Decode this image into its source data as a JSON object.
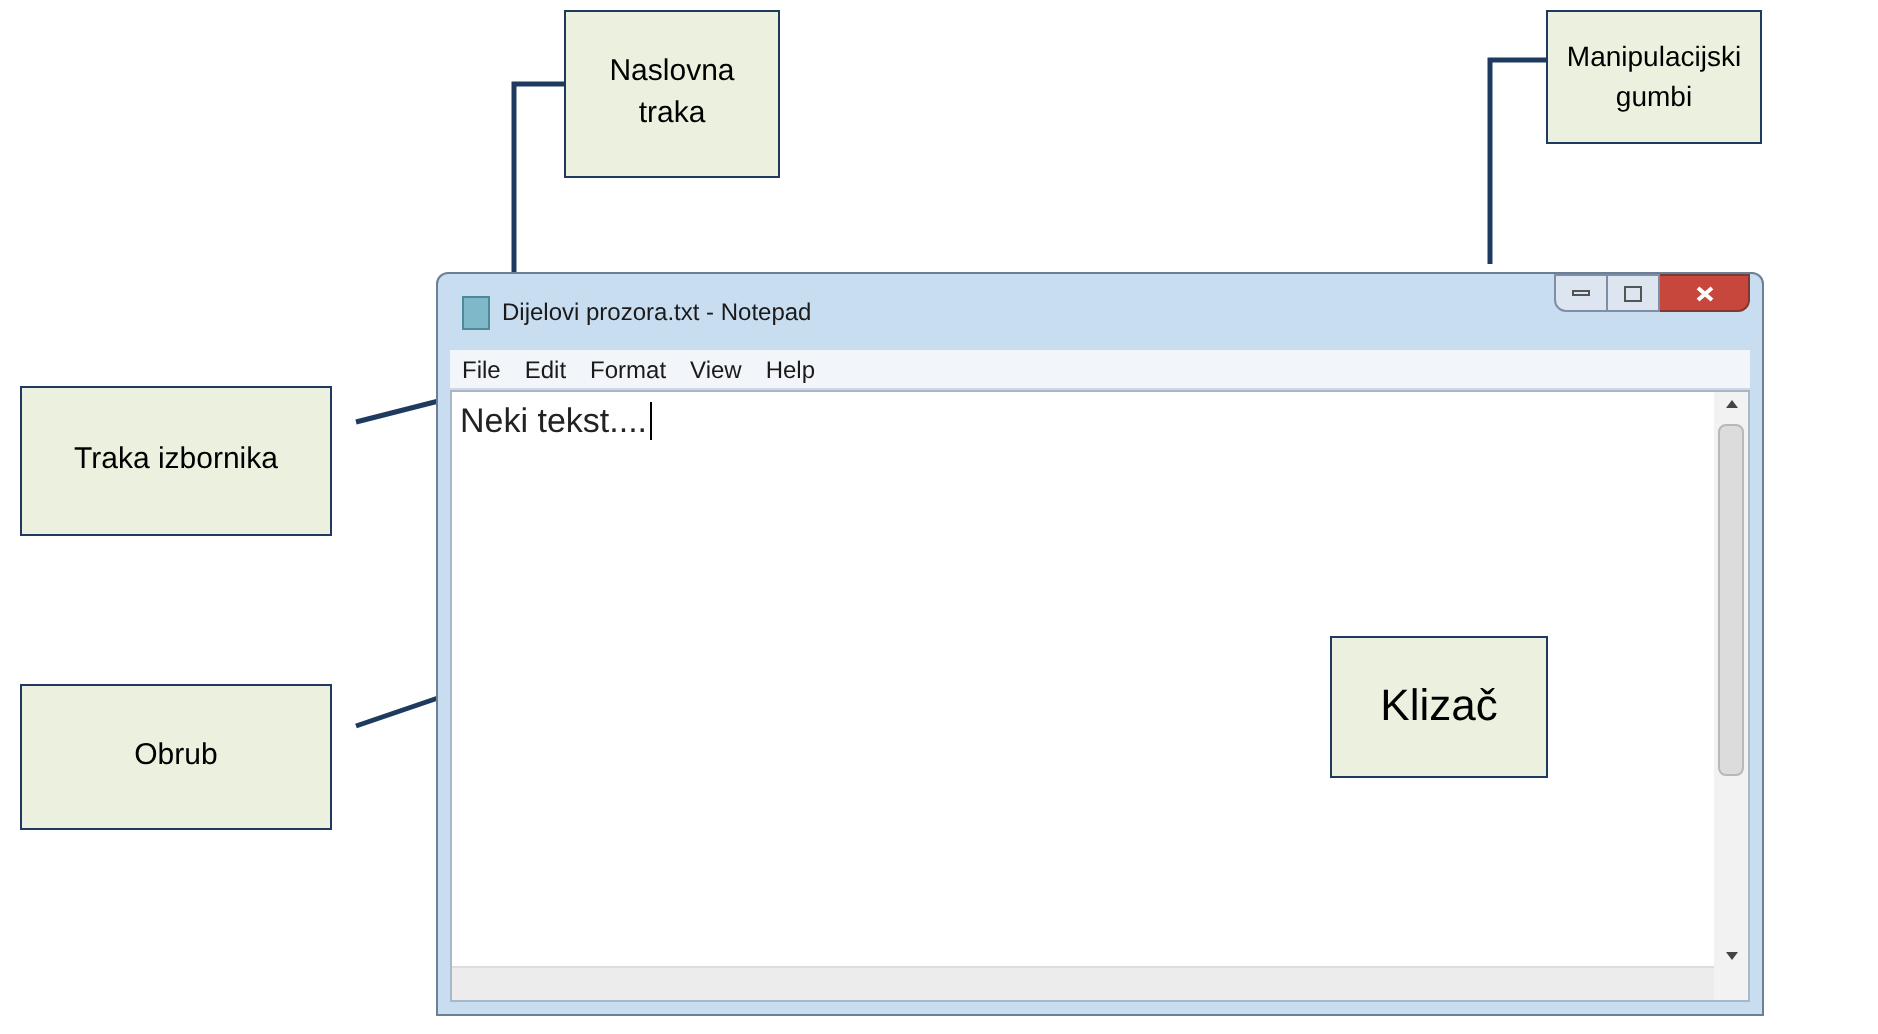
{
  "window": {
    "title": "Dijelovi prozora.txt - Notepad"
  },
  "menu": [
    "File",
    "Edit",
    "Format",
    "View",
    "Help"
  ],
  "document": {
    "text": "Neki tekst...."
  },
  "callouts": [
    {
      "kind": "title",
      "text": "Naslovna traka"
    },
    {
      "kind": "buttons",
      "text": "Manipulacijski gumbi"
    },
    {
      "kind": "menu",
      "text": "Traka izbornika"
    },
    {
      "kind": "border",
      "text": "Obrub"
    },
    {
      "kind": "scrollbar",
      "text": "Klizač"
    }
  ]
}
